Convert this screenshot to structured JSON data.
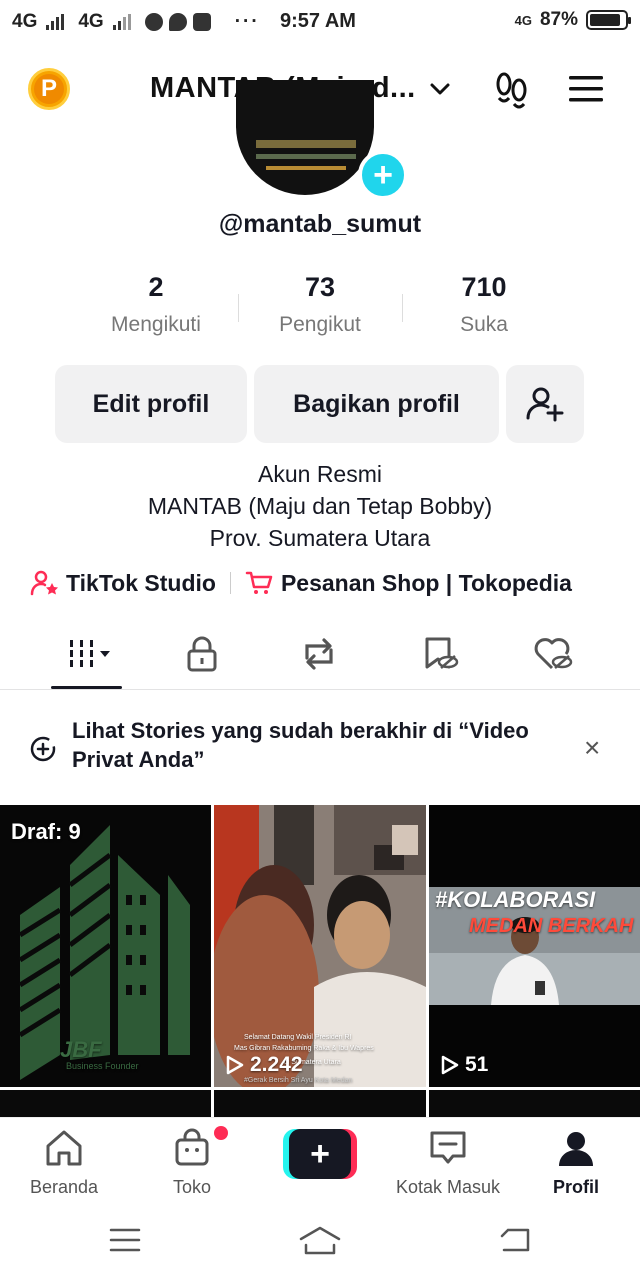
{
  "status_bar": {
    "network1": "4G",
    "network2": "4G",
    "time": "9:57 AM",
    "net_right": "4G",
    "battery": "87%",
    "battery_level": 0.87
  },
  "header": {
    "account_name": "MANTAB (Maju d...",
    "points_badge": "P"
  },
  "profile": {
    "username": "@mantab_sumut",
    "stats": [
      {
        "value": "2",
        "label": "Mengikuti"
      },
      {
        "value": "73",
        "label": "Pengikut"
      },
      {
        "value": "710",
        "label": "Suka"
      }
    ],
    "buttons": {
      "edit": "Edit profil",
      "share": "Bagikan profil"
    },
    "bio": [
      "Akun Resmi",
      "MANTAB (Maju dan Tetap Bobby)",
      "Prov. Sumatera Utara"
    ],
    "links": {
      "studio": "TikTok Studio",
      "shop": "Pesanan Shop | Tokopedia"
    }
  },
  "tabs": [
    "videos-grid-icon",
    "lock-icon",
    "repost-icon",
    "saved-icon",
    "liked-icon"
  ],
  "notice": {
    "text": "Lihat Stories yang sudah berakhir di “Video Privat Anda”",
    "close": "×"
  },
  "grid": {
    "draft_label": "Draf: 9",
    "video1": {
      "views": "2.242",
      "caption1": "Selamat Datang Wakil Presiden RI",
      "caption2": "Mas Gibran Rakabuming Raka & Ibu Wapres",
      "caption3": "di Sumatera Utara",
      "caption4": "#Gerak Bersih Sri Ayu Kota Medan"
    },
    "video2": {
      "views": "51",
      "banner1": "#KOLABORASI",
      "banner2": "MEDAN BERKAH"
    },
    "draft_brand": "JBF",
    "draft_brand_sub": "Business Founder"
  },
  "bottom_nav": [
    {
      "label": "Beranda",
      "icon": "home-icon"
    },
    {
      "label": "Toko",
      "icon": "shop-icon"
    },
    {
      "label": "",
      "icon": "create-icon"
    },
    {
      "label": "Kotak Masuk",
      "icon": "inbox-icon"
    },
    {
      "label": "Profil",
      "icon": "profile-icon"
    }
  ],
  "colors": {
    "accent_cyan": "#20d5ec",
    "accent_red": "#fe2c55",
    "text_dark": "#161823"
  }
}
